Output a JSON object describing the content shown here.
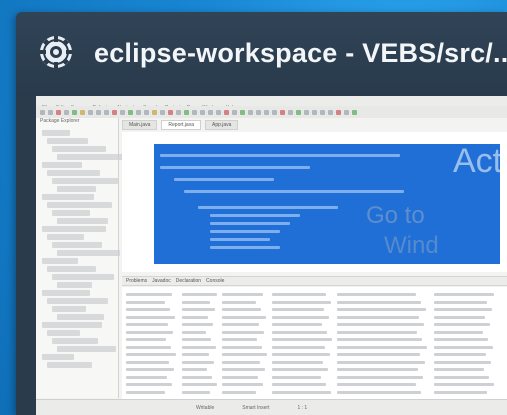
{
  "window": {
    "title": "eclipse-workspace - VEBS/src/...",
    "icon": "eclipse-icon"
  },
  "thumbnail": {
    "menu_items": [
      "File",
      "Edit",
      "Source",
      "Refactor",
      "Navigate",
      "Search",
      "Project",
      "Run",
      "Window",
      "Help"
    ],
    "left_tabs": "Package Explorer",
    "editor_tabs": [
      "Main.java",
      "Report.java",
      "App.java"
    ],
    "console_tabs": [
      "Problems",
      "Javadoc",
      "Declaration",
      "Console"
    ],
    "status_items": [
      "Writable",
      "Smart Insert",
      "1 : 1"
    ],
    "watermark_lines": [
      "Act",
      "Go to",
      "Wind"
    ]
  },
  "colors": {
    "desktop": "#1f8fd8",
    "card": "#2a3b4c",
    "selection": "#1f6fd6"
  }
}
